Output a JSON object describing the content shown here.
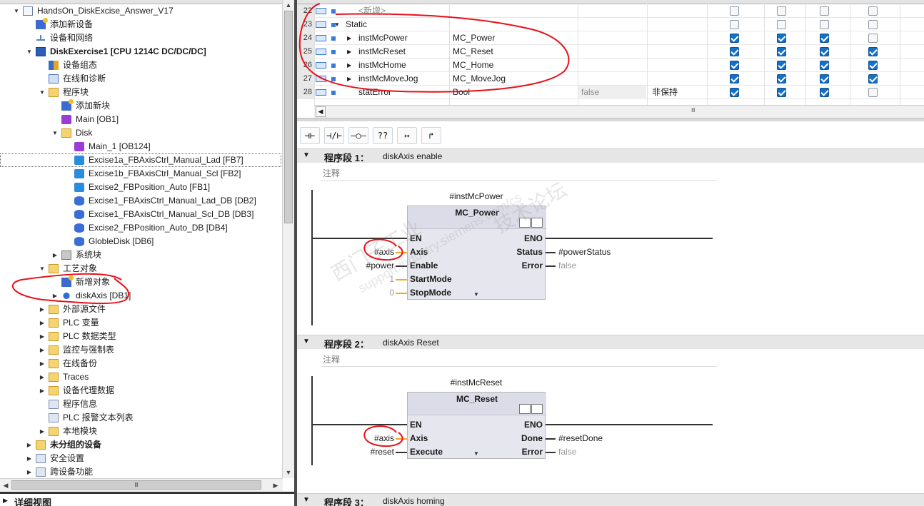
{
  "tree": {
    "items": [
      {
        "label": "HandsOn_DiskExcise_Answer_V17",
        "indent": 0,
        "twisty": "▼",
        "icon": "doc",
        "bold": false
      },
      {
        "label": "添加新设备",
        "indent": 1,
        "twisty": "",
        "icon": "add",
        "bold": false
      },
      {
        "label": "设备和网络",
        "indent": 1,
        "twisty": "",
        "icon": "net",
        "bold": false
      },
      {
        "label": "DiskExercise1 [CPU 1214C DC/DC/DC]",
        "indent": 1,
        "twisty": "▼",
        "icon": "plc",
        "bold": true
      },
      {
        "label": "设备组态",
        "indent": 2,
        "twisty": "",
        "icon": "cfg",
        "bold": false
      },
      {
        "label": "在线和诊断",
        "indent": 2,
        "twisty": "",
        "icon": "diag",
        "bold": false
      },
      {
        "label": "程序块",
        "indent": 2,
        "twisty": "▼",
        "icon": "folder",
        "bold": false
      },
      {
        "label": "添加新块",
        "indent": 3,
        "twisty": "",
        "icon": "add",
        "bold": false
      },
      {
        "label": "Main [OB1]",
        "indent": 3,
        "twisty": "",
        "icon": "ob",
        "bold": false
      },
      {
        "label": "Disk",
        "indent": 3,
        "twisty": "▼",
        "icon": "folder",
        "bold": false
      },
      {
        "label": "Main_1 [OB124]",
        "indent": 4,
        "twisty": "",
        "icon": "ob",
        "bold": false
      },
      {
        "label": "Excise1a_FBAxisCtrl_Manual_Lad [FB7]",
        "indent": 4,
        "twisty": "",
        "icon": "fb",
        "bold": false,
        "selected": true
      },
      {
        "label": "Excise1b_FBAxisCtrl_Manual_Scl [FB2]",
        "indent": 4,
        "twisty": "",
        "icon": "fb",
        "bold": false
      },
      {
        "label": "Excise2_FBPosition_Auto [FB1]",
        "indent": 4,
        "twisty": "",
        "icon": "fb",
        "bold": false
      },
      {
        "label": "Excise1_FBAxisCtrl_Manual_Lad_DB [DB2]",
        "indent": 4,
        "twisty": "",
        "icon": "db",
        "bold": false
      },
      {
        "label": "Excise1_FBAxisCtrl_Manual_Scl_DB [DB3]",
        "indent": 4,
        "twisty": "",
        "icon": "db",
        "bold": false
      },
      {
        "label": "Excise2_FBPosition_Auto_DB [DB4]",
        "indent": 4,
        "twisty": "",
        "icon": "db",
        "bold": false
      },
      {
        "label": "GlobleDisk [DB6]",
        "indent": 4,
        "twisty": "",
        "icon": "db",
        "bold": false
      },
      {
        "label": "系统块",
        "indent": 3,
        "twisty": "▶",
        "icon": "sys",
        "bold": false
      },
      {
        "label": "工艺对象",
        "indent": 2,
        "twisty": "▼",
        "icon": "tech",
        "bold": false
      },
      {
        "label": "新增对象",
        "indent": 3,
        "twisty": "",
        "icon": "add",
        "bold": false
      },
      {
        "label": "diskAxis [DB1]",
        "indent": 3,
        "twisty": "▶",
        "icon": "axis",
        "bold": false
      },
      {
        "label": "外部源文件",
        "indent": 2,
        "twisty": "▶",
        "icon": "folder",
        "bold": false
      },
      {
        "label": "PLC 变量",
        "indent": 2,
        "twisty": "▶",
        "icon": "folder",
        "bold": false
      },
      {
        "label": "PLC 数据类型",
        "indent": 2,
        "twisty": "▶",
        "icon": "folder",
        "bold": false
      },
      {
        "label": "监控与强制表",
        "indent": 2,
        "twisty": "▶",
        "icon": "folder",
        "bold": false
      },
      {
        "label": "在线备份",
        "indent": 2,
        "twisty": "▶",
        "icon": "folder",
        "bold": false
      },
      {
        "label": "Traces",
        "indent": 2,
        "twisty": "▶",
        "icon": "folder",
        "bold": false
      },
      {
        "label": "设备代理数据",
        "indent": 2,
        "twisty": "▶",
        "icon": "folder",
        "bold": false
      },
      {
        "label": "程序信息",
        "indent": 2,
        "twisty": "",
        "icon": "gen",
        "bold": false
      },
      {
        "label": "PLC 报警文本列表",
        "indent": 2,
        "twisty": "",
        "icon": "gen",
        "bold": false
      },
      {
        "label": "本地模块",
        "indent": 2,
        "twisty": "▶",
        "icon": "folder",
        "bold": false
      },
      {
        "label": "未分组的设备",
        "indent": 1,
        "twisty": "▶",
        "icon": "folder",
        "bold": true
      },
      {
        "label": "安全设置",
        "indent": 1,
        "twisty": "▶",
        "icon": "gen",
        "bold": false
      },
      {
        "label": "跨设备功能",
        "indent": 1,
        "twisty": "▶",
        "icon": "gen",
        "bold": false
      }
    ],
    "scroll_grip": "Ⅲ",
    "detail_view": "详细视图"
  },
  "iface": {
    "rows": [
      {
        "num": "22",
        "name": "<新增>",
        "dtype": "",
        "default": "",
        "retain": "",
        "exp": "",
        "c": [
          0,
          0,
          0,
          0
        ],
        "placeholder": true,
        "level": 2
      },
      {
        "num": "23",
        "name": "Static",
        "dtype": "",
        "default": "",
        "retain": "",
        "exp": "▼",
        "c": [
          0,
          0,
          0,
          0
        ],
        "level": 1
      },
      {
        "num": "24",
        "name": "instMcPower",
        "dtype": "MC_Power",
        "default": "",
        "retain": "",
        "exp": "▶",
        "c": [
          1,
          1,
          1,
          0
        ],
        "level": 2
      },
      {
        "num": "25",
        "name": "instMcReset",
        "dtype": "MC_Reset",
        "default": "",
        "retain": "",
        "exp": "▶",
        "c": [
          1,
          1,
          1,
          1
        ],
        "level": 2
      },
      {
        "num": "26",
        "name": "instMcHome",
        "dtype": "MC_Home",
        "default": "",
        "retain": "",
        "exp": "▶",
        "c": [
          1,
          1,
          1,
          1
        ],
        "level": 2
      },
      {
        "num": "27",
        "name": "instMcMoveJog",
        "dtype": "MC_MoveJog",
        "default": "",
        "retain": "",
        "exp": "▶",
        "c": [
          1,
          1,
          1,
          1
        ],
        "level": 2
      },
      {
        "num": "28",
        "name": "statError",
        "dtype": "Bool",
        "default": "false",
        "retain": "非保持",
        "exp": "",
        "c": [
          1,
          1,
          1,
          0
        ],
        "level": 2
      }
    ],
    "grip": "Ⅲ"
  },
  "toolbar": {
    "buttons": [
      "⊣⊢",
      "⊣/⊢",
      "–○–",
      "??",
      "↦",
      "↱"
    ]
  },
  "networks": [
    {
      "title": "程序段 1：",
      "comment_text": "diskAxis enable",
      "comment_label": "注释",
      "instance": "#instMcPower",
      "block": "MC_Power",
      "left_pins": [
        "EN",
        "Axis",
        "Enable",
        "StartMode",
        "StopMode"
      ],
      "left_ops": [
        "",
        "#axis",
        "#power",
        "1",
        "0"
      ],
      "right_pins": [
        "ENO",
        "Status",
        "Error"
      ],
      "right_ops": [
        "",
        "#powerStatus",
        "false"
      ]
    },
    {
      "title": "程序段 2：",
      "comment_text": "diskAxis Reset",
      "comment_label": "注释",
      "instance": "#instMcReset",
      "block": "MC_Reset",
      "left_pins": [
        "EN",
        "Axis",
        "Execute"
      ],
      "left_ops": [
        "",
        "#axis",
        "#reset"
      ],
      "right_pins": [
        "ENO",
        "Done",
        "Error"
      ],
      "right_ops": [
        "",
        "#resetDone",
        "false"
      ]
    },
    {
      "title": "程序段 3：",
      "comment_text": "diskAxis homing"
    }
  ],
  "watermark": [
    "西门子工业",
    "support.industry.siemens.com/cs",
    "技术论坛"
  ],
  "colors": {
    "accent": "#1470c8",
    "annotation": "#e8101a",
    "pin_wire": "#f5a623",
    "selection_outline": "#6a6a6a"
  }
}
